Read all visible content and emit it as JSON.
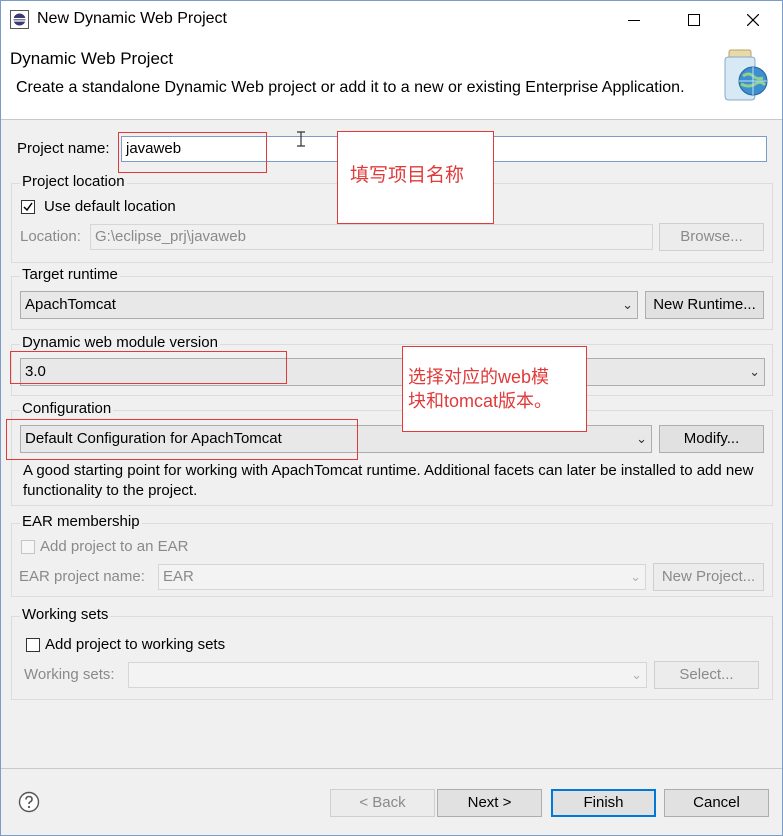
{
  "window": {
    "title": "New Dynamic Web Project"
  },
  "header": {
    "title": "Dynamic Web Project",
    "description": "Create a standalone Dynamic Web project or add it to a new or existing Enterprise Application."
  },
  "project_name": {
    "label": "Project name:",
    "value": "javaweb"
  },
  "project_location": {
    "group_label": "Project location",
    "use_default_label": "Use default location",
    "use_default_checked": true,
    "location_label": "Location:",
    "location_value": "G:\\eclipse_prj\\javaweb",
    "browse_label": "Browse..."
  },
  "target_runtime": {
    "group_label": "Target runtime",
    "value": "ApachTomcat",
    "new_runtime_label": "New Runtime..."
  },
  "module_version": {
    "group_label": "Dynamic web module version",
    "value": "3.0"
  },
  "configuration": {
    "group_label": "Configuration",
    "value": "Default Configuration for ApachTomcat",
    "modify_label": "Modify...",
    "description": "A good starting point for working with ApachTomcat  runtime. Additional facets can later be installed to add new functionality to the project."
  },
  "ear": {
    "group_label": "EAR membership",
    "add_label": "Add project to an EAR",
    "add_checked": false,
    "name_label": "EAR project name:",
    "name_value": "EAR",
    "new_project_label": "New Project..."
  },
  "working_sets": {
    "group_label": "Working sets",
    "add_label": "Add project to working sets",
    "add_checked": false,
    "sets_label": "Working sets:",
    "select_label": "Select..."
  },
  "footer": {
    "back_label": "< Back",
    "next_label": "Next >",
    "finish_label": "Finish",
    "cancel_label": "Cancel"
  },
  "annotations": {
    "name_note": "填写项目名称",
    "version_note_line1": "选择对应的web模",
    "version_note_line2": "块和tomcat版本。"
  },
  "colors": {
    "annotation": "#e03a3a",
    "focus": "#0078d7"
  }
}
